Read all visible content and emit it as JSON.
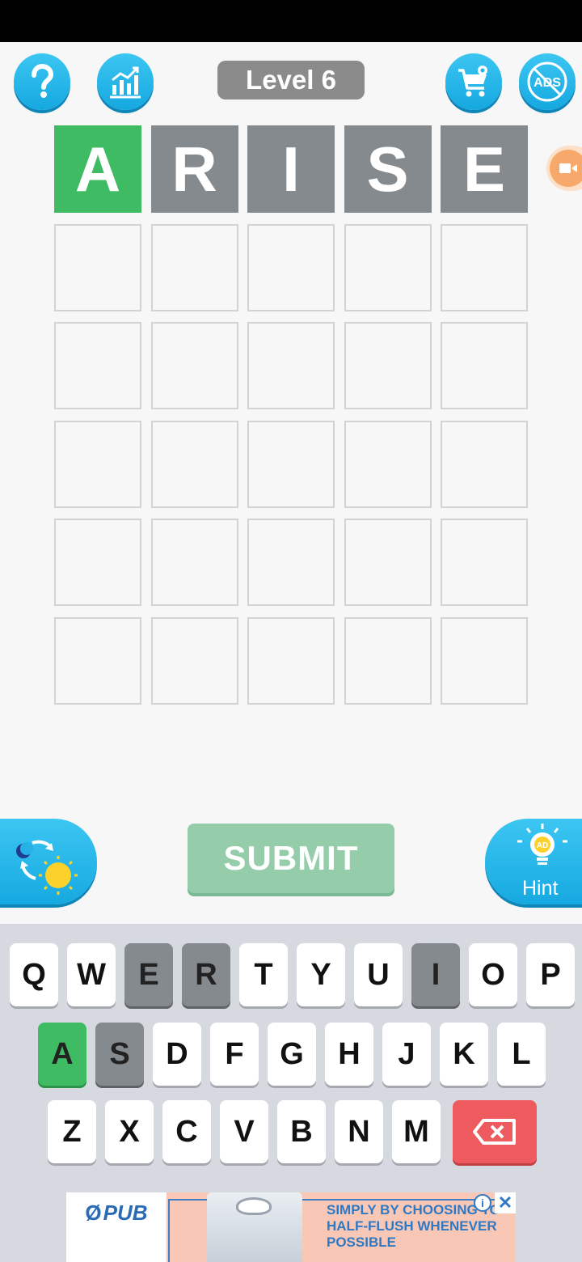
{
  "header": {
    "level_label": "Level 6",
    "buttons": {
      "help": "question-icon",
      "stats": "bar-chart-icon",
      "shop": "shopping-cart-icon",
      "no_ads": "ads-icon",
      "no_ads_text": "ADS"
    }
  },
  "board": {
    "rows": 6,
    "columns": 5,
    "guesses": [
      [
        {
          "letter": "A",
          "state": "correct"
        },
        {
          "letter": "R",
          "state": "absent"
        },
        {
          "letter": "I",
          "state": "absent"
        },
        {
          "letter": "S",
          "state": "absent"
        },
        {
          "letter": "E",
          "state": "absent"
        }
      ]
    ]
  },
  "actions": {
    "submit_label": "SUBMIT",
    "hint_label": "Hint",
    "hint_badge": "AD",
    "theme_toggle": "day-night-icon"
  },
  "keyboard": {
    "rows": [
      [
        "Q",
        "W",
        "E",
        "R",
        "T",
        "Y",
        "U",
        "I",
        "O",
        "P"
      ],
      [
        "A",
        "S",
        "D",
        "F",
        "G",
        "H",
        "J",
        "K",
        "L"
      ],
      [
        "Z",
        "X",
        "C",
        "V",
        "B",
        "N",
        "M"
      ]
    ],
    "states": {
      "A": "correct",
      "E": "absent",
      "R": "absent",
      "I": "absent",
      "S": "absent"
    },
    "backspace": "backspace-icon"
  },
  "ad": {
    "brand": "PUB",
    "text": "SIMPLY BY CHOOSING TO HALF-FLUSH WHENEVER POSSIBLE",
    "info_label": "i",
    "close_label": "✕"
  },
  "colors": {
    "correct": "#3fbc63",
    "absent": "#858a8e",
    "accent_blue": "#1eb4e8",
    "submit_disabled": "#95cdaa",
    "backspace": "#ee5b5e"
  }
}
